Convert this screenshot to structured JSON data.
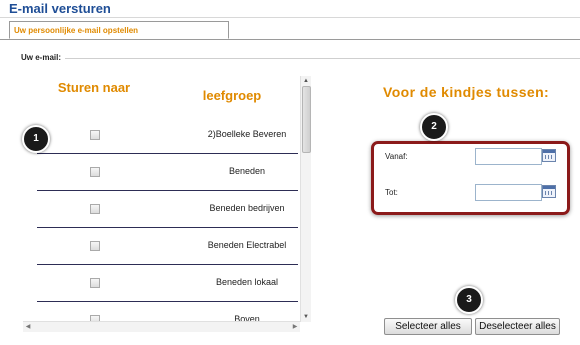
{
  "page": {
    "title": "E-mail versturen"
  },
  "tabs": [
    {
      "label": "Uw persoonlijke e-mail opstellen",
      "active": true
    }
  ],
  "section": {
    "label": "Uw e-mail:"
  },
  "list": {
    "header_send": "Sturen naar",
    "header_group": "leefgroep",
    "rows": [
      {
        "label": "2)Boelleke Beveren",
        "checked": false
      },
      {
        "label": "Beneden",
        "checked": false
      },
      {
        "label": "Beneden bedrijven",
        "checked": false
      },
      {
        "label": "Beneden Electrabel",
        "checked": false
      },
      {
        "label": "Beneden lokaal",
        "checked": false
      },
      {
        "label": "Boven",
        "checked": false
      }
    ]
  },
  "date_range": {
    "heading": "Voor de kindjes tussen:",
    "from_label": "Vanaf:",
    "from_value": "",
    "to_label": "Tot:",
    "to_value": ""
  },
  "buttons": {
    "select_all": "Selecteer alles",
    "deselect_all": "Deselecteer alles"
  },
  "callouts": [
    "1",
    "2",
    "3"
  ],
  "colors": {
    "title": "#1f4e96",
    "accent_orange": "#e08a00",
    "highlight_red": "#8b1a1a"
  }
}
